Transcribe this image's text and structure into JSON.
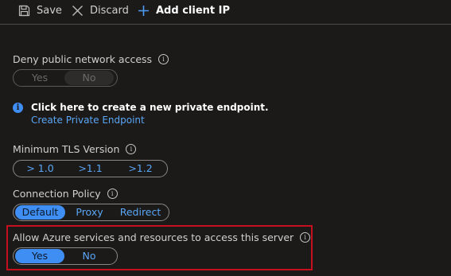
{
  "toolbar": {
    "save_label": "Save",
    "discard_label": "Discard",
    "add_client_ip_label": "Add client IP"
  },
  "deny_public_access": {
    "label": "Deny public network access",
    "options": [
      "Yes",
      "No"
    ],
    "selected": "No",
    "disabled": true
  },
  "private_endpoint": {
    "message": "Click here to create a new private endpoint.",
    "link_label": "Create Private Endpoint"
  },
  "min_tls": {
    "label": "Minimum TLS Version",
    "options": [
      "> 1.0",
      ">1.1",
      ">1.2"
    ]
  },
  "connection_policy": {
    "label": "Connection Policy",
    "options": [
      "Default",
      "Proxy",
      "Redirect"
    ],
    "selected": "Default"
  },
  "allow_azure_services": {
    "label": "Allow Azure services and resources to access this server",
    "options": [
      "Yes",
      "No"
    ],
    "selected": "Yes"
  },
  "colors": {
    "background": "#1b1a19",
    "accent": "#3f8ef4",
    "link": "#5aa6f5",
    "highlight_border": "#c50f1f"
  },
  "icons": {
    "save": "save-icon",
    "discard": "close-icon",
    "add": "plus-icon",
    "info": "info-icon"
  }
}
